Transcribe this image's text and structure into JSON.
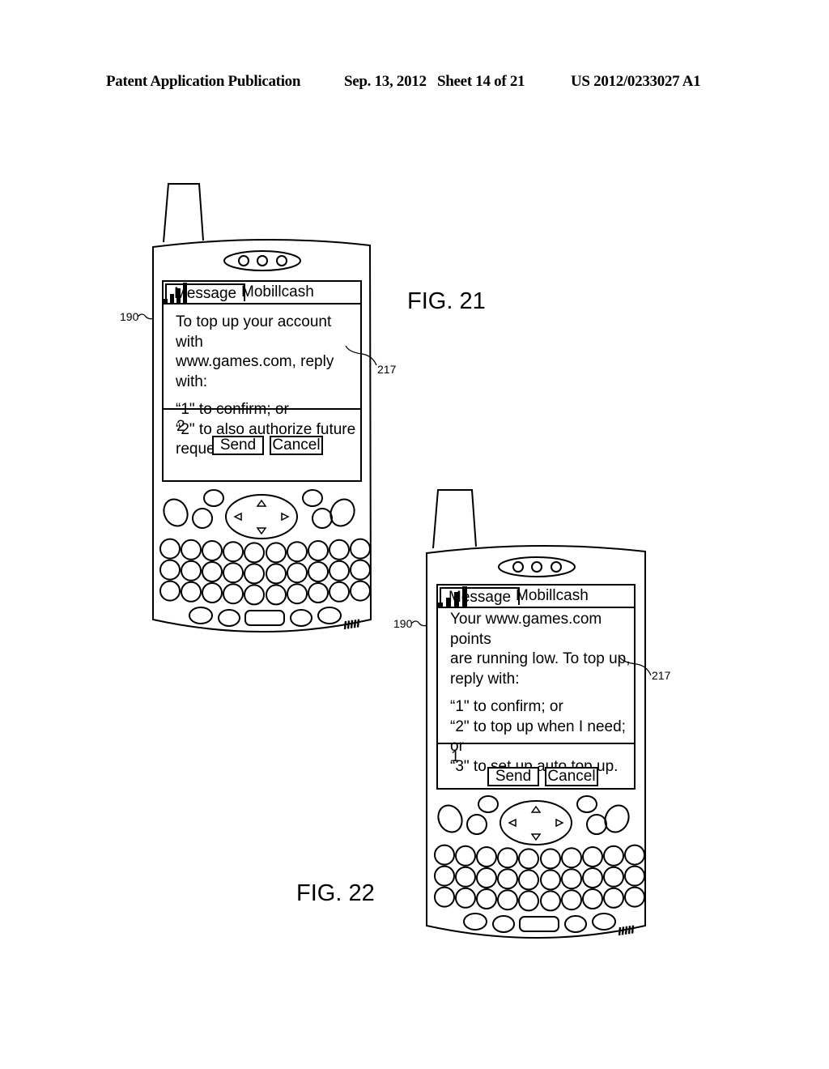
{
  "header": {
    "publication": "Patent Application Publication",
    "date_sheet": "Sep. 13, 2012   Sheet 14 of 21",
    "patent_number": "US 2012/0233027 A1"
  },
  "figures": [
    {
      "label": "FIG. 21",
      "device_ref": "190",
      "message_ref": "217",
      "tabs": {
        "message": "Message",
        "app": "Mobillcash"
      },
      "signal_icon": "signal-bars",
      "message_lines": [
        "To top up your account with",
        "www.games.com, reply with:"
      ],
      "option_lines": [
        "“1\" to confirm; or",
        "“2\" to also authorize future",
        "requests."
      ],
      "reply_value": "2",
      "buttons": {
        "send": "Send",
        "cancel": "Cancel"
      }
    },
    {
      "label": "FIG. 22",
      "device_ref": "190",
      "message_ref": "217",
      "tabs": {
        "message": "Message",
        "app": "Mobillcash"
      },
      "signal_icon": "signal-bars",
      "message_lines": [
        "Your www.games.com points",
        "are running low.  To top up,",
        "reply with:"
      ],
      "option_lines": [
        "“1\" to confirm; or",
        "“2\" to top up when I need; or",
        "“3\" to set up auto top up."
      ],
      "reply_value": "1",
      "buttons": {
        "send": "Send",
        "cancel": "Cancel"
      }
    }
  ]
}
